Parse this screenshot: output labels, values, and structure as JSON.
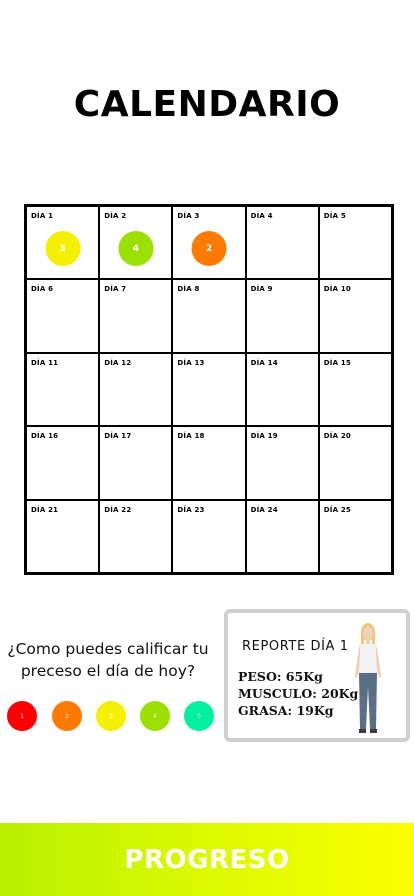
{
  "header": {
    "title": "CALENDARIO"
  },
  "calendar": {
    "days": [
      {
        "label": "DÍA 1",
        "score": "3",
        "color": "#f5f000"
      },
      {
        "label": "DÍA 2",
        "score": "4",
        "color": "#9be000"
      },
      {
        "label": "DÍA 3",
        "score": "2",
        "color": "#ff7a00"
      },
      {
        "label": "DÍA 4"
      },
      {
        "label": "DÍA 5"
      },
      {
        "label": "DÍA 6"
      },
      {
        "label": "DÍA 7"
      },
      {
        "label": "DÍA 8"
      },
      {
        "label": "DÍA 9"
      },
      {
        "label": "DÍA 10"
      },
      {
        "label": "DÍA 11"
      },
      {
        "label": "DÍA 12"
      },
      {
        "label": "DÍA 13"
      },
      {
        "label": "DÍA 14"
      },
      {
        "label": "DÍA 15"
      },
      {
        "label": "DÍA 16"
      },
      {
        "label": "DÍA 17"
      },
      {
        "label": "DÍA 18"
      },
      {
        "label": "DÍA 19"
      },
      {
        "label": "DÍA 20"
      },
      {
        "label": "DÍA 21"
      },
      {
        "label": "DÍA 22"
      },
      {
        "label": "DÍA 23"
      },
      {
        "label": "DÍA 24"
      },
      {
        "label": "DÍA 25"
      }
    ]
  },
  "rating": {
    "question_line1": "¿Como puedes calificar tu",
    "question_line2": "preceso el día de hoy?",
    "options": [
      {
        "label": "1",
        "color": "#ff0000"
      },
      {
        "label": "2",
        "color": "#ff7a00"
      },
      {
        "label": "3",
        "color": "#f5f000"
      },
      {
        "label": "4",
        "color": "#9be000"
      },
      {
        "label": "5",
        "color": "#00f0a0"
      }
    ]
  },
  "report": {
    "title": "REPORTE DÍA 1",
    "peso": "PESO: 65Kg",
    "musculo": "MUSCULO: 20Kg",
    "grasa": "GRASA: 19Kg"
  },
  "footer": {
    "label": "PROGRESO"
  }
}
